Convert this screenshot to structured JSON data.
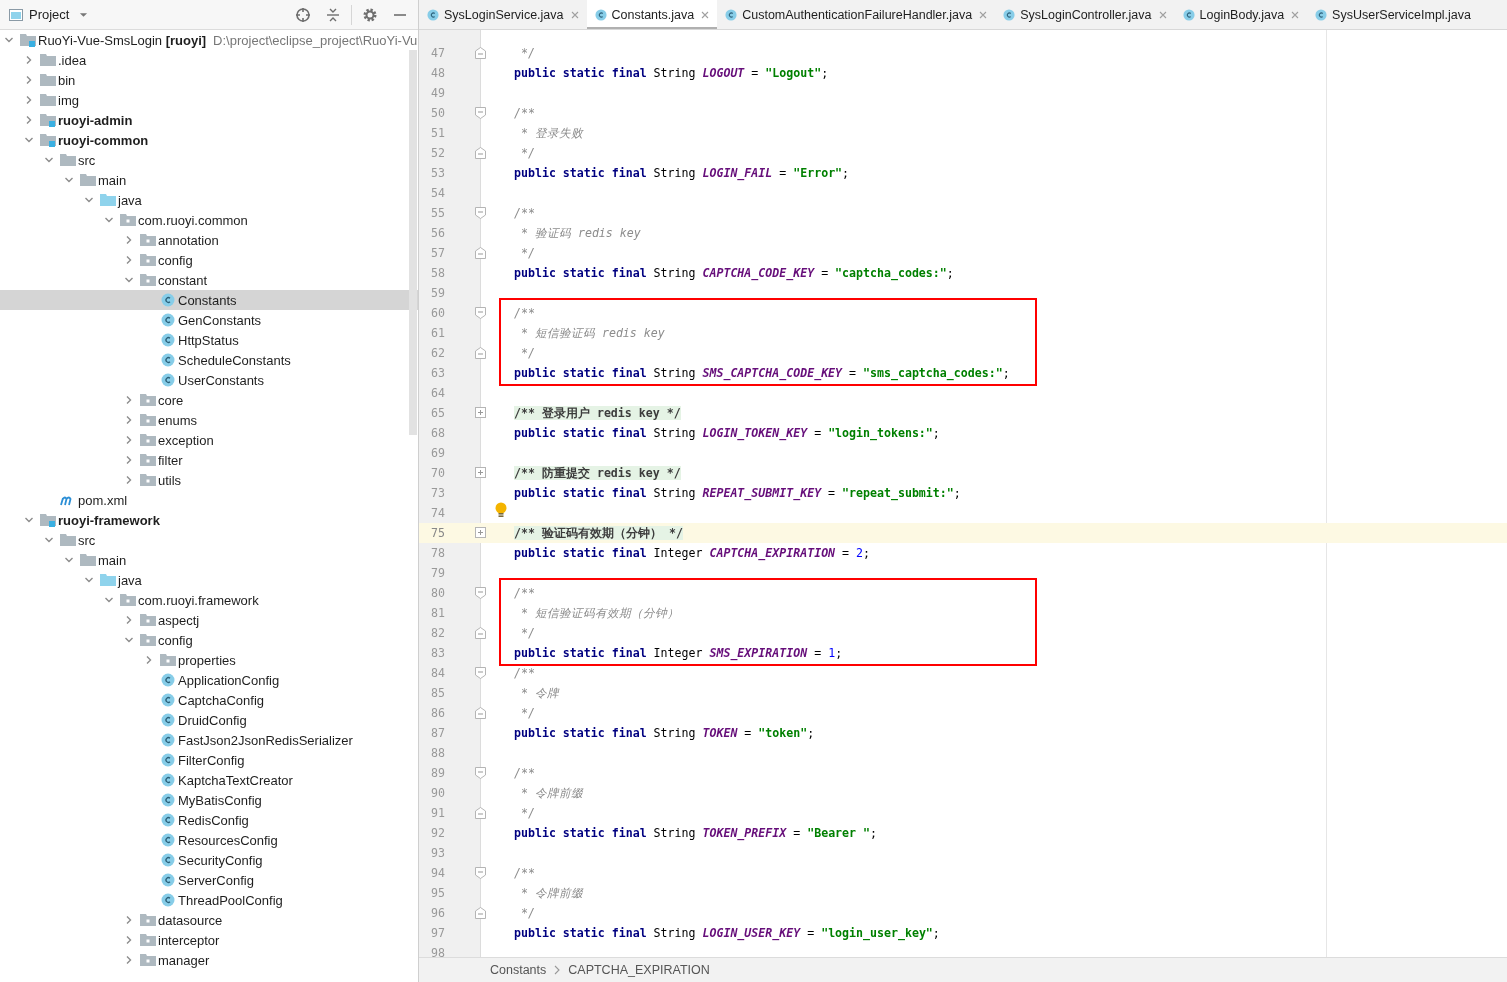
{
  "project_panel": {
    "title": "Project",
    "tree": [
      {
        "label": "RuoYi-Vue-SmsLogin **[ruoyi]**",
        "path": "D:\\project\\eclipse_project\\RuoYi-Vu",
        "kind": "project",
        "selected": false,
        "expanded": true,
        "children": [
          {
            "label": ".idea",
            "kind": "folder",
            "selected": false,
            "expanded": false
          },
          {
            "label": "bin",
            "kind": "folder",
            "selected": false,
            "expanded": false
          },
          {
            "label": "img",
            "kind": "folder",
            "selected": false,
            "expanded": false
          },
          {
            "label": "ruoyi-admin",
            "kind": "module",
            "selected": false,
            "expanded": false
          },
          {
            "label": "ruoyi-common",
            "kind": "module",
            "selected": false,
            "expanded": true,
            "children": [
              {
                "label": "src",
                "kind": "folder",
                "selected": false,
                "expanded": true,
                "children": [
                  {
                    "label": "main",
                    "kind": "folder",
                    "selected": false,
                    "expanded": true,
                    "children": [
                      {
                        "label": "java",
                        "kind": "source",
                        "selected": false,
                        "expanded": true,
                        "children": [
                          {
                            "label": "com.ruoyi.common",
                            "kind": "package",
                            "selected": false,
                            "expanded": true,
                            "children": [
                              {
                                "label": "annotation",
                                "kind": "package",
                                "selected": false,
                                "expanded": false
                              },
                              {
                                "label": "config",
                                "kind": "package",
                                "selected": false,
                                "expanded": false
                              },
                              {
                                "label": "constant",
                                "kind": "package",
                                "selected": false,
                                "expanded": true,
                                "children": [
                                  {
                                    "label": "Constants",
                                    "kind": "class",
                                    "selected": true
                                  },
                                  {
                                    "label": "GenConstants",
                                    "kind": "class",
                                    "selected": false
                                  },
                                  {
                                    "label": "HttpStatus",
                                    "kind": "class",
                                    "selected": false
                                  },
                                  {
                                    "label": "ScheduleConstants",
                                    "kind": "class",
                                    "selected": false
                                  },
                                  {
                                    "label": "UserConstants",
                                    "kind": "class",
                                    "selected": false
                                  }
                                ]
                              },
                              {
                                "label": "core",
                                "kind": "package",
                                "selected": false,
                                "expanded": false
                              },
                              {
                                "label": "enums",
                                "kind": "package",
                                "selected": false,
                                "expanded": false
                              },
                              {
                                "label": "exception",
                                "kind": "package",
                                "selected": false,
                                "expanded": false
                              },
                              {
                                "label": "filter",
                                "kind": "package",
                                "selected": false,
                                "expanded": false
                              },
                              {
                                "label": "utils",
                                "kind": "package",
                                "selected": false,
                                "expanded": false
                              }
                            ]
                          }
                        ]
                      }
                    ]
                  }
                ]
              },
              {
                "label": "pom.xml",
                "kind": "maven",
                "selected": false
              }
            ]
          },
          {
            "label": "ruoyi-framework",
            "kind": "module",
            "selected": false,
            "expanded": true,
            "children": [
              {
                "label": "src",
                "kind": "folder",
                "selected": false,
                "expanded": true,
                "children": [
                  {
                    "label": "main",
                    "kind": "folder",
                    "selected": false,
                    "expanded": true,
                    "children": [
                      {
                        "label": "java",
                        "kind": "source",
                        "selected": false,
                        "expanded": true,
                        "children": [
                          {
                            "label": "com.ruoyi.framework",
                            "kind": "package",
                            "selected": false,
                            "expanded": true,
                            "children": [
                              {
                                "label": "aspectj",
                                "kind": "package",
                                "selected": false,
                                "expanded": false
                              },
                              {
                                "label": "config",
                                "kind": "package",
                                "selected": false,
                                "expanded": true,
                                "children": [
                                  {
                                    "label": "properties",
                                    "kind": "package",
                                    "selected": false,
                                    "expanded": false
                                  },
                                  {
                                    "label": "ApplicationConfig",
                                    "kind": "class",
                                    "selected": false
                                  },
                                  {
                                    "label": "CaptchaConfig",
                                    "kind": "class",
                                    "selected": false
                                  },
                                  {
                                    "label": "DruidConfig",
                                    "kind": "class",
                                    "selected": false
                                  },
                                  {
                                    "label": "FastJson2JsonRedisSerializer",
                                    "kind": "class",
                                    "selected": false
                                  },
                                  {
                                    "label": "FilterConfig",
                                    "kind": "class",
                                    "selected": false
                                  },
                                  {
                                    "label": "KaptchaTextCreator",
                                    "kind": "class",
                                    "selected": false
                                  },
                                  {
                                    "label": "MyBatisConfig",
                                    "kind": "class",
                                    "selected": false
                                  },
                                  {
                                    "label": "RedisConfig",
                                    "kind": "class",
                                    "selected": false
                                  },
                                  {
                                    "label": "ResourcesConfig",
                                    "kind": "class",
                                    "selected": false
                                  },
                                  {
                                    "label": "SecurityConfig",
                                    "kind": "class",
                                    "selected": false
                                  },
                                  {
                                    "label": "ServerConfig",
                                    "kind": "class",
                                    "selected": false
                                  },
                                  {
                                    "label": "ThreadPoolConfig",
                                    "kind": "class",
                                    "selected": false
                                  }
                                ]
                              },
                              {
                                "label": "datasource",
                                "kind": "package",
                                "selected": false,
                                "expanded": false
                              },
                              {
                                "label": "interceptor",
                                "kind": "package",
                                "selected": false,
                                "expanded": false
                              },
                              {
                                "label": "manager",
                                "kind": "package",
                                "selected": false,
                                "expanded": false
                              }
                            ]
                          }
                        ]
                      }
                    ]
                  }
                ]
              }
            ]
          }
        ]
      }
    ]
  },
  "tabs": [
    {
      "label": "SysLoginService.java",
      "selected": false,
      "closable": true
    },
    {
      "label": "Constants.java",
      "selected": true,
      "closable": true
    },
    {
      "label": "CustomAuthenticationFailureHandler.java",
      "selected": false,
      "closable": true
    },
    {
      "label": "SysLoginController.java",
      "selected": false,
      "closable": true
    },
    {
      "label": "LoginBody.java",
      "selected": false,
      "closable": true
    },
    {
      "label": "SysUserServiceImpl.java",
      "selected": false,
      "closable": false
    }
  ],
  "code_lines": [
    {
      "number": "47",
      "fold_close": true,
      "parts": [
        {
          "kind": "comment",
          "text": " */"
        }
      ]
    },
    {
      "number": "48",
      "parts": [
        {
          "kind": "keyword",
          "text": "public static final"
        },
        {
          "kind": "plain",
          "text": " String "
        },
        {
          "kind": "constant",
          "text": "LOGOUT"
        },
        {
          "kind": "plain",
          "text": " = "
        },
        {
          "kind": "string",
          "text": "\"Logout\""
        },
        {
          "kind": "plain",
          "text": ";"
        }
      ]
    },
    {
      "number": "49"
    },
    {
      "number": "50",
      "fold_open": true,
      "parts": [
        {
          "kind": "comment",
          "text": "/**"
        }
      ]
    },
    {
      "number": "51",
      "parts": [
        {
          "kind": "comment",
          "text": " * 登录失败"
        }
      ]
    },
    {
      "number": "52",
      "fold_close": true,
      "parts": [
        {
          "kind": "comment",
          "text": " */"
        }
      ]
    },
    {
      "number": "53",
      "parts": [
        {
          "kind": "keyword",
          "text": "public static final"
        },
        {
          "kind": "plain",
          "text": " String "
        },
        {
          "kind": "constant",
          "text": "LOGIN_FAIL"
        },
        {
          "kind": "plain",
          "text": " = "
        },
        {
          "kind": "string",
          "text": "\"Error\""
        },
        {
          "kind": "plain",
          "text": ";"
        }
      ]
    },
    {
      "number": "54"
    },
    {
      "number": "55",
      "fold_open": true,
      "parts": [
        {
          "kind": "comment",
          "text": "/**"
        }
      ]
    },
    {
      "number": "56",
      "parts": [
        {
          "kind": "comment",
          "text": " * 验证码 redis key"
        }
      ]
    },
    {
      "number": "57",
      "fold_close": true,
      "parts": [
        {
          "kind": "comment",
          "text": " */"
        }
      ]
    },
    {
      "number": "58",
      "parts": [
        {
          "kind": "keyword",
          "text": "public static final"
        },
        {
          "kind": "plain",
          "text": " String "
        },
        {
          "kind": "constant",
          "text": "CAPTCHA_CODE_KEY"
        },
        {
          "kind": "plain",
          "text": " = "
        },
        {
          "kind": "string",
          "text": "\"captcha_codes:\""
        },
        {
          "kind": "plain",
          "text": ";"
        }
      ]
    },
    {
      "number": "59"
    },
    {
      "number": "60",
      "fold_open": true,
      "boxed": true,
      "parts": [
        {
          "kind": "comment",
          "text": "/**"
        }
      ]
    },
    {
      "number": "61",
      "boxed": true,
      "parts": [
        {
          "kind": "comment",
          "text": " * 短信验证码 redis key"
        }
      ]
    },
    {
      "number": "62",
      "fold_close": true,
      "boxed": true,
      "parts": [
        {
          "kind": "comment",
          "text": " */"
        }
      ]
    },
    {
      "number": "63",
      "boxed": true,
      "parts": [
        {
          "kind": "keyword",
          "text": "public static final"
        },
        {
          "kind": "plain",
          "text": " String "
        },
        {
          "kind": "constant",
          "text": "SMS_CAPTCHA_CODE_KEY"
        },
        {
          "kind": "plain",
          "text": " = "
        },
        {
          "kind": "string",
          "text": "\"sms_captcha_codes:\""
        },
        {
          "kind": "plain",
          "text": ";"
        }
      ]
    },
    {
      "number": "64"
    },
    {
      "number": "65",
      "collapsed": true,
      "parts": [
        {
          "kind": "folded",
          "text": "/** 登录用户 redis key */"
        }
      ]
    },
    {
      "number": "68",
      "parts": [
        {
          "kind": "keyword",
          "text": "public static final"
        },
        {
          "kind": "plain",
          "text": " String "
        },
        {
          "kind": "constant",
          "text": "LOGIN_TOKEN_KEY"
        },
        {
          "kind": "plain",
          "text": " = "
        },
        {
          "kind": "string",
          "text": "\"login_tokens:\""
        },
        {
          "kind": "plain",
          "text": ";"
        }
      ]
    },
    {
      "number": "69"
    },
    {
      "number": "70",
      "collapsed": true,
      "parts": [
        {
          "kind": "folded",
          "text": "/** 防重提交 redis key */"
        }
      ]
    },
    {
      "number": "73",
      "parts": [
        {
          "kind": "keyword",
          "text": "public static final"
        },
        {
          "kind": "plain",
          "text": " String "
        },
        {
          "kind": "constant",
          "text": "REPEAT_SUBMIT_KEY"
        },
        {
          "kind": "plain",
          "text": " = "
        },
        {
          "kind": "string",
          "text": "\"repeat_submit:\""
        },
        {
          "kind": "plain",
          "text": ";"
        }
      ]
    },
    {
      "number": "74",
      "hint": true
    },
    {
      "number": "75",
      "collapsed": true,
      "current": true,
      "parts": [
        {
          "kind": "folded",
          "text": "/** 验证码有效期（分钟） */"
        }
      ]
    },
    {
      "number": "78",
      "parts": [
        {
          "kind": "keyword",
          "text": "public static final"
        },
        {
          "kind": "plain",
          "text": " Integer "
        },
        {
          "kind": "constant",
          "text": "CAPTCHA_EXPIRATION"
        },
        {
          "kind": "plain",
          "text": " = "
        },
        {
          "kind": "number",
          "text": "2"
        },
        {
          "kind": "plain",
          "text": ";"
        }
      ]
    },
    {
      "number": "79"
    },
    {
      "number": "80",
      "fold_open": true,
      "boxed": true,
      "parts": [
        {
          "kind": "comment",
          "text": "/**"
        }
      ]
    },
    {
      "number": "81",
      "boxed": true,
      "parts": [
        {
          "kind": "comment",
          "text": " * 短信验证码有效期（分钟）"
        }
      ]
    },
    {
      "number": "82",
      "fold_close": true,
      "boxed": true,
      "parts": [
        {
          "kind": "comment",
          "text": " */"
        }
      ]
    },
    {
      "number": "83",
      "boxed": true,
      "parts": [
        {
          "kind": "keyword",
          "text": "public static final"
        },
        {
          "kind": "plain",
          "text": " Integer "
        },
        {
          "kind": "constant",
          "text": "SMS_EXPIRATION"
        },
        {
          "kind": "plain",
          "text": " = "
        },
        {
          "kind": "number",
          "text": "1"
        },
        {
          "kind": "plain",
          "text": ";"
        }
      ]
    },
    {
      "number": "84",
      "fold_open": true,
      "parts": [
        {
          "kind": "comment",
          "text": "/**"
        }
      ]
    },
    {
      "number": "85",
      "parts": [
        {
          "kind": "comment",
          "text": " * 令牌"
        }
      ]
    },
    {
      "number": "86",
      "fold_close": true,
      "parts": [
        {
          "kind": "comment",
          "text": " */"
        }
      ]
    },
    {
      "number": "87",
      "parts": [
        {
          "kind": "keyword",
          "text": "public static final"
        },
        {
          "kind": "plain",
          "text": " String "
        },
        {
          "kind": "constant",
          "text": "TOKEN"
        },
        {
          "kind": "plain",
          "text": " = "
        },
        {
          "kind": "string",
          "text": "\"token\""
        },
        {
          "kind": "plain",
          "text": ";"
        }
      ]
    },
    {
      "number": "88"
    },
    {
      "number": "89",
      "fold_open": true,
      "parts": [
        {
          "kind": "comment",
          "text": "/**"
        }
      ]
    },
    {
      "number": "90",
      "parts": [
        {
          "kind": "comment",
          "text": " * 令牌前缀"
        }
      ]
    },
    {
      "number": "91",
      "fold_close": true,
      "parts": [
        {
          "kind": "comment",
          "text": " */"
        }
      ]
    },
    {
      "number": "92",
      "parts": [
        {
          "kind": "keyword",
          "text": "public static final"
        },
        {
          "kind": "plain",
          "text": " String "
        },
        {
          "kind": "constant",
          "text": "TOKEN_PREFIX"
        },
        {
          "kind": "plain",
          "text": " = "
        },
        {
          "kind": "string",
          "text": "\"Bearer \""
        },
        {
          "kind": "plain",
          "text": ";"
        }
      ]
    },
    {
      "number": "93"
    },
    {
      "number": "94",
      "fold_open": true,
      "parts": [
        {
          "kind": "comment",
          "text": "/**"
        }
      ]
    },
    {
      "number": "95",
      "parts": [
        {
          "kind": "comment",
          "text": " * 令牌前缀"
        }
      ]
    },
    {
      "number": "96",
      "fold_close": true,
      "parts": [
        {
          "kind": "comment",
          "text": " */"
        }
      ]
    },
    {
      "number": "97",
      "parts": [
        {
          "kind": "keyword",
          "text": "public static final"
        },
        {
          "kind": "plain",
          "text": " String "
        },
        {
          "kind": "constant",
          "text": "LOGIN_USER_KEY"
        },
        {
          "kind": "plain",
          "text": " = "
        },
        {
          "kind": "string",
          "text": "\"login_user_key\""
        },
        {
          "kind": "plain",
          "text": ";"
        }
      ]
    },
    {
      "number": "98"
    }
  ],
  "breadcrumb": [
    "Constants",
    "CAPTCHA_EXPIRATION"
  ]
}
